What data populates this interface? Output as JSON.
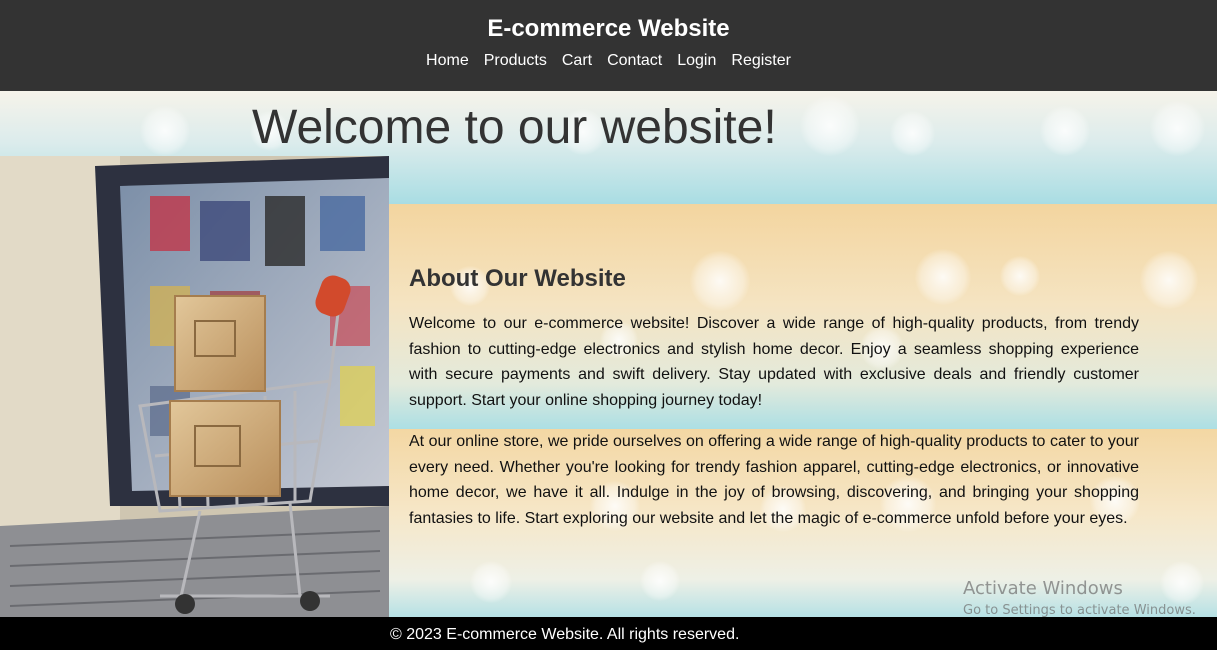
{
  "header": {
    "title": "E-commerce Website",
    "nav": [
      "Home",
      "Products",
      "Cart",
      "Contact",
      "Login",
      "Register"
    ]
  },
  "main": {
    "welcome_heading": "Welcome to our website!",
    "about_heading": "About Our Website",
    "paragraph_1": "Welcome to our e-commerce website! Discover a wide range of high-quality products, from trendy fashion to cutting-edge electronics and stylish home decor. Enjoy a seamless shopping experience with secure payments and swift delivery. Stay updated with exclusive deals and friendly customer support. Start your online shopping journey today!",
    "paragraph_2": "At our online store, we pride ourselves on offering a wide range of high-quality products to cater to your every need. Whether you're looking for trendy fashion apparel, cutting-edge electronics, or innovative home decor, we have it all. Indulge in the joy of browsing, discovering, and bringing your shopping fantasies to life. Start exploring our website and let the magic of e-commerce unfold before your eyes."
  },
  "watermark": {
    "line_1": "Activate Windows",
    "line_2": "Go to Settings to activate Windows."
  },
  "footer": {
    "copyright": "© 2023 E-commerce Website. All rights reserved."
  },
  "colors": {
    "header_bg": "#333333",
    "footer_bg": "#000000",
    "accent_teal": "#a9dde3",
    "accent_peach": "#f3d59f"
  }
}
